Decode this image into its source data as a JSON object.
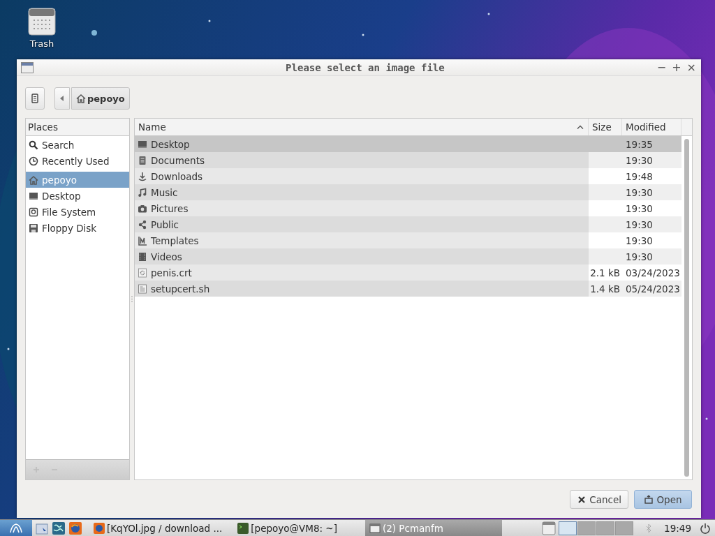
{
  "desktop": {
    "icons": [
      {
        "label": "Trash",
        "kind": "trash"
      }
    ]
  },
  "dialog": {
    "title": "Please select an image file",
    "controls": [
      "−",
      "+",
      "×"
    ],
    "path": [
      {
        "label": "pepoyo",
        "kind": "home"
      }
    ],
    "places": {
      "header": "Places",
      "items": [
        {
          "label": "Search",
          "kind": "search",
          "selected": false
        },
        {
          "label": "Recently Used",
          "kind": "recent",
          "selected": false
        },
        {
          "label": "pepoyo",
          "kind": "home",
          "selected": true
        },
        {
          "label": "Desktop",
          "kind": "desktop",
          "selected": false
        },
        {
          "label": "File System",
          "kind": "drive",
          "selected": false
        },
        {
          "label": "Floppy Disk",
          "kind": "floppy",
          "selected": false
        }
      ]
    },
    "table": {
      "columns": [
        "Name",
        "Size",
        "Modified"
      ],
      "rows": [
        {
          "name": "Desktop",
          "kind": "desktop",
          "size": "",
          "modified": "19:35",
          "selected": true
        },
        {
          "name": "Documents",
          "kind": "documents",
          "size": "",
          "modified": "19:30",
          "selected": false
        },
        {
          "name": "Downloads",
          "kind": "downloads",
          "size": "",
          "modified": "19:48",
          "selected": false
        },
        {
          "name": "Music",
          "kind": "music",
          "size": "",
          "modified": "19:30",
          "selected": false
        },
        {
          "name": "Pictures",
          "kind": "pictures",
          "size": "",
          "modified": "19:30",
          "selected": false
        },
        {
          "name": "Public",
          "kind": "public",
          "size": "",
          "modified": "19:30",
          "selected": false
        },
        {
          "name": "Templates",
          "kind": "templates",
          "size": "",
          "modified": "19:30",
          "selected": false
        },
        {
          "name": "Videos",
          "kind": "videos",
          "size": "",
          "modified": "19:30",
          "selected": false
        },
        {
          "name": "penis.crt",
          "kind": "certificate",
          "size": "2.1 kB",
          "modified": "03/24/2023",
          "selected": false
        },
        {
          "name": "setupcert.sh",
          "kind": "script",
          "size": "1.4 kB",
          "modified": "05/24/2023",
          "selected": false
        }
      ]
    },
    "buttons": [
      {
        "label": "Cancel",
        "kind": "cancel"
      },
      {
        "label": "Open",
        "kind": "open"
      }
    ]
  },
  "taskbar": {
    "tasks": [
      {
        "label": "[KqYOl.jpg / download ...",
        "kind": "browser",
        "selected": false
      },
      {
        "label": "[pepoyo@VM8: ~]",
        "kind": "terminal",
        "selected": false
      },
      {
        "label": "(2) Pcmanfm",
        "kind": "window",
        "selected": true
      }
    ],
    "desktops": [
      {
        "selected": true
      },
      {
        "selected": false
      },
      {
        "selected": false
      },
      {
        "selected": false
      }
    ],
    "clock": "19:49"
  }
}
